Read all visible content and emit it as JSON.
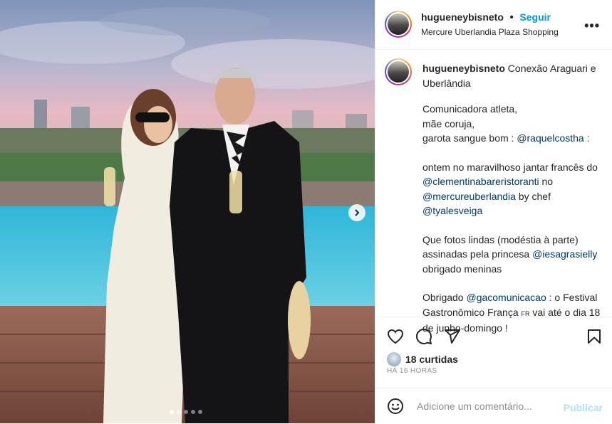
{
  "post": {
    "username": "hugueneybisneto",
    "separator": "•",
    "follow_label": "Seguir",
    "location": "Mercure Uberlandia Plaza Shopping",
    "more_icon": "more-options-icon",
    "carousel": {
      "total_slides": 5,
      "active_slide": 1
    }
  },
  "caption": {
    "username": "hugueneybisneto",
    "title_text": " Conexão Araguari e Uberlândia",
    "line1": "Comunicadora atleta,",
    "line2": "mãe coruja,",
    "line3_prefix": "garota sangue bom : ",
    "line3_mention": "@raquelcostha",
    "line3_suffix": " :",
    "line4_text": "ontem no maravilhoso jantar francês do ",
    "line4_mention1": "@clementinabareristoranti",
    "line4_mid": " no ",
    "line4_mention2": "@mercureuberlandia",
    "line4_mid2": " by chef ",
    "line4_mention3": "@tyalesveiga",
    "line5_text": "Que fotos lindas (modéstia à parte) assinadas pela princesa ",
    "line5_mention": "@iesagrasielly",
    "line5_suffix": " obrigado meninas",
    "line6_prefix": "Obrigado ",
    "line6_mention": "@gacomunicacao",
    "line6_text": " : o Festival Gastronômico França ",
    "line6_flag": "FR",
    "line6_suffix": " vai até o dia 18 de junho-domingo !"
  },
  "actions": {
    "like_icon": "heart-icon",
    "comment_icon": "comment-icon",
    "share_icon": "share-icon",
    "save_icon": "bookmark-icon",
    "likes_text": "18 curtidas",
    "time_text": "HÁ 16 HORAS"
  },
  "comment_box": {
    "placeholder": "Adicione um comentário...",
    "publish_label": "Publicar",
    "emoji_icon": "emoji-icon"
  },
  "colors": {
    "accent": "#0095f6",
    "mention": "#00376b",
    "publish_disabled": "#b2dffc"
  }
}
